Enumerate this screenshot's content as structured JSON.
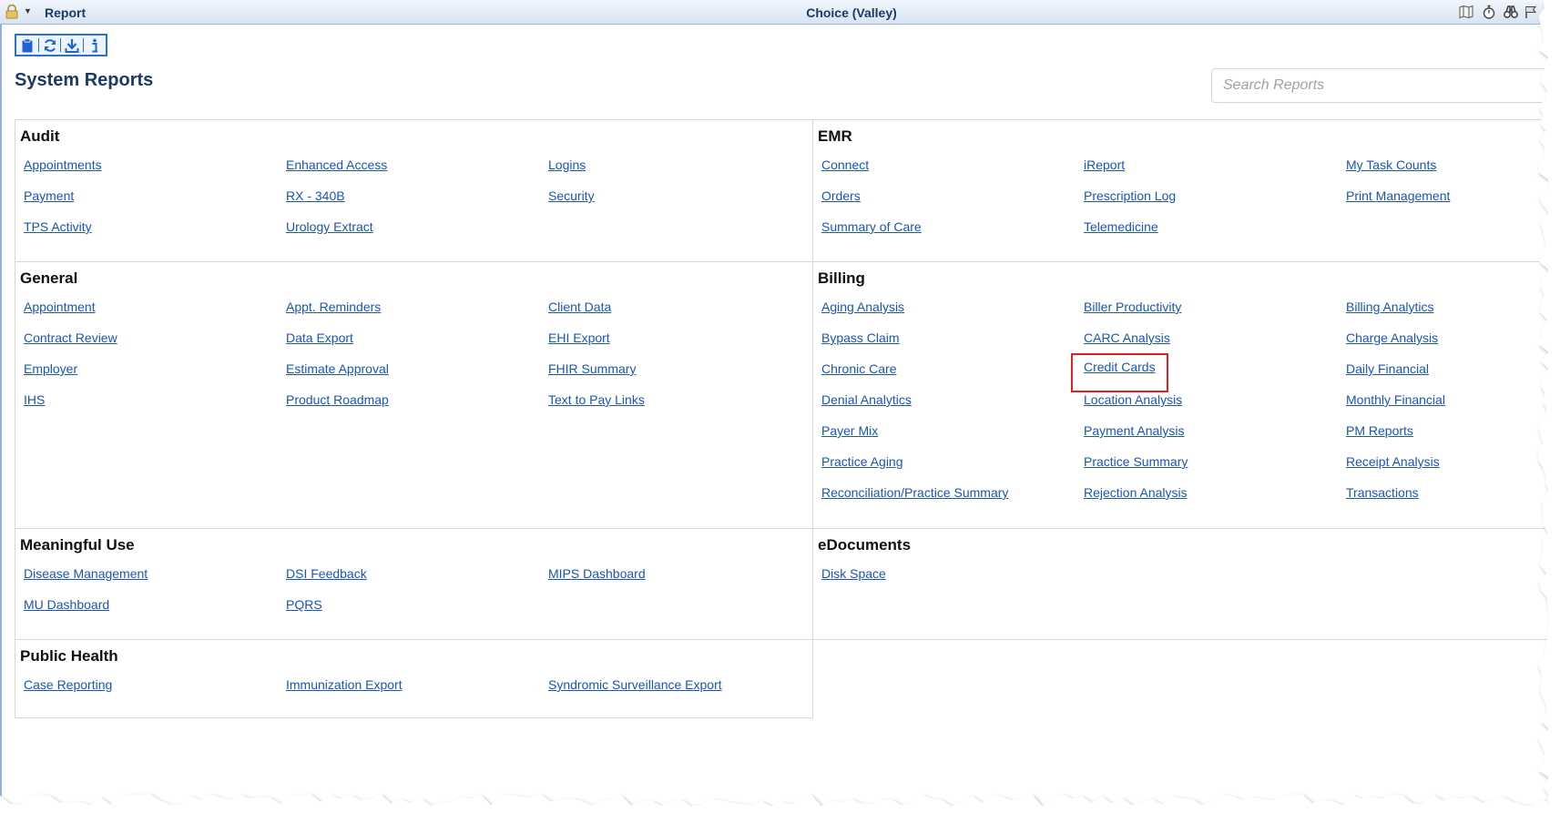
{
  "window": {
    "title_left": "Report",
    "title_center": "Choice (Valley)"
  },
  "page": {
    "title": "System Reports",
    "search_placeholder": "Search Reports"
  },
  "colors": {
    "accent": "#2a6fd6",
    "link": "#1a55b8",
    "highlight": "#e02020",
    "title": "#1b3a67"
  },
  "icons": {
    "titlebar": [
      "lock-icon",
      "chevron-down-icon",
      "map-icon",
      "stopwatch-icon",
      "binoculars-icon",
      "flag-icon"
    ],
    "toolbar": [
      "clipboard-icon",
      "refresh-icon",
      "download-icon",
      "info-icon"
    ]
  },
  "sections": {
    "audit": {
      "title": "Audit",
      "links": [
        "Appointments",
        "Enhanced Access",
        "Logins",
        "Payment",
        "RX - 340B",
        "Security",
        "TPS Activity",
        "Urology Extract"
      ]
    },
    "emr": {
      "title": "EMR",
      "links": [
        "Connect",
        "iReport",
        "My Task Counts",
        "Orders",
        "Prescription Log",
        "Print Management",
        "Summary of Care",
        "Telemedicine"
      ]
    },
    "general": {
      "title": "General",
      "links": [
        "Appointment",
        "Appt. Reminders",
        "Client Data",
        "Contract Review",
        "Data Export",
        "EHI Export",
        "Employer",
        "Estimate Approval",
        "FHIR Summary",
        "IHS",
        "Product Roadmap",
        "Text to Pay Links"
      ]
    },
    "billing": {
      "title": "Billing",
      "links": [
        "Aging Analysis",
        "Biller Productivity",
        "Billing Analytics",
        "Bypass Claim",
        "CARC Analysis",
        "Charge Analysis",
        "Chronic Care",
        "Credit Cards",
        "Daily Financial",
        "Denial Analytics",
        "Location Analysis",
        "Monthly Financial",
        "Payer Mix",
        "Payment Analysis",
        "PM Reports",
        "Practice Aging",
        "Practice Summary",
        "Receipt Analysis",
        "Reconciliation/Practice Summary",
        "Rejection Analysis",
        "Transactions"
      ],
      "highlighted": "Credit Cards"
    },
    "meaningful_use": {
      "title": "Meaningful Use",
      "links": [
        "Disease Management",
        "DSI Feedback",
        "MIPS Dashboard",
        "MU Dashboard",
        "PQRS"
      ]
    },
    "edocuments": {
      "title": "eDocuments",
      "links": [
        "Disk Space"
      ]
    },
    "public_health": {
      "title": "Public Health",
      "links": [
        "Case Reporting",
        "Immunization Export",
        "Syndromic Surveillance Export"
      ]
    }
  }
}
